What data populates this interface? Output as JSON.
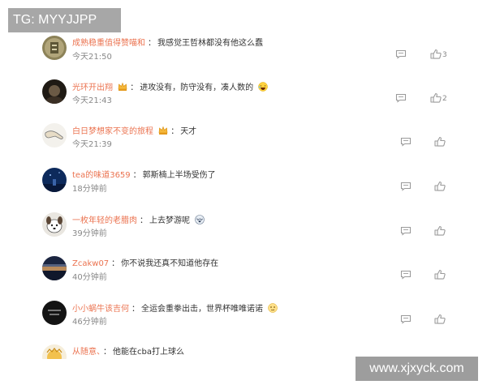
{
  "watermarks": {
    "top_left": "TG: MYYJJPP",
    "bottom_right": "www.xjxyck.com"
  },
  "comments": [
    {
      "username": "成熟稳重值得赞喵和",
      "separator": "：",
      "text": "我感觉王哲林都没有他这么蠢",
      "time": "今天21:50",
      "likes": "3",
      "avatar": "avatar-icon-gold-seal",
      "badge": null,
      "emoji": null
    },
    {
      "username": "光环开出翔",
      "separator": "：",
      "text": "进攻没有，防守没有，凑人数的",
      "time": "今天21:43",
      "likes": "2",
      "avatar": "avatar-icon-dark-portrait",
      "badge": "crown-badge-icon",
      "emoji": "laughing-emoji-icon"
    },
    {
      "username": "白日梦想家不变的旅程",
      "separator": "：",
      "text": "天才",
      "time": "今天21:39",
      "likes": "",
      "avatar": "avatar-icon-sketch-hand",
      "badge": "crown-badge-icon",
      "emoji": null
    },
    {
      "username": "tea的味道3659",
      "separator": "：",
      "text": "郭斯楠上半场受伤了",
      "time": "18分钟前",
      "likes": "",
      "avatar": "avatar-icon-blue-night",
      "badge": null,
      "emoji": null
    },
    {
      "username": "一枚年轻的老腊肉",
      "separator": "：",
      "text": "上去梦游呢",
      "time": "39分钟前",
      "likes": "",
      "avatar": "avatar-icon-cartoon-dog",
      "badge": null,
      "emoji": "dizzy-emoji-icon"
    },
    {
      "username": "Zcakw07",
      "separator": "：",
      "text": "你不说我还真不知道他存在",
      "time": "40分钟前",
      "likes": "",
      "avatar": "avatar-icon-sunset-sky",
      "badge": null,
      "emoji": null
    },
    {
      "username": "小小蜗牛该吉何",
      "separator": "：",
      "text": "全运会重拳出击，世界杯唯唯诺诺",
      "time": "46分钟前",
      "likes": "",
      "avatar": "avatar-icon-dark-text",
      "badge": null,
      "emoji": "smug-emoji-icon"
    },
    {
      "username": "从随意、",
      "separator": "：",
      "text": "他能在cba打上球么",
      "time": "",
      "likes": "",
      "avatar": "avatar-icon-sun-face",
      "badge": null,
      "emoji": null
    }
  ],
  "colors": {
    "username": "#eb7350",
    "text": "#333333",
    "meta": "#888888",
    "icon": "#9a9a9a",
    "watermark_bg": "#a7a7a7"
  }
}
